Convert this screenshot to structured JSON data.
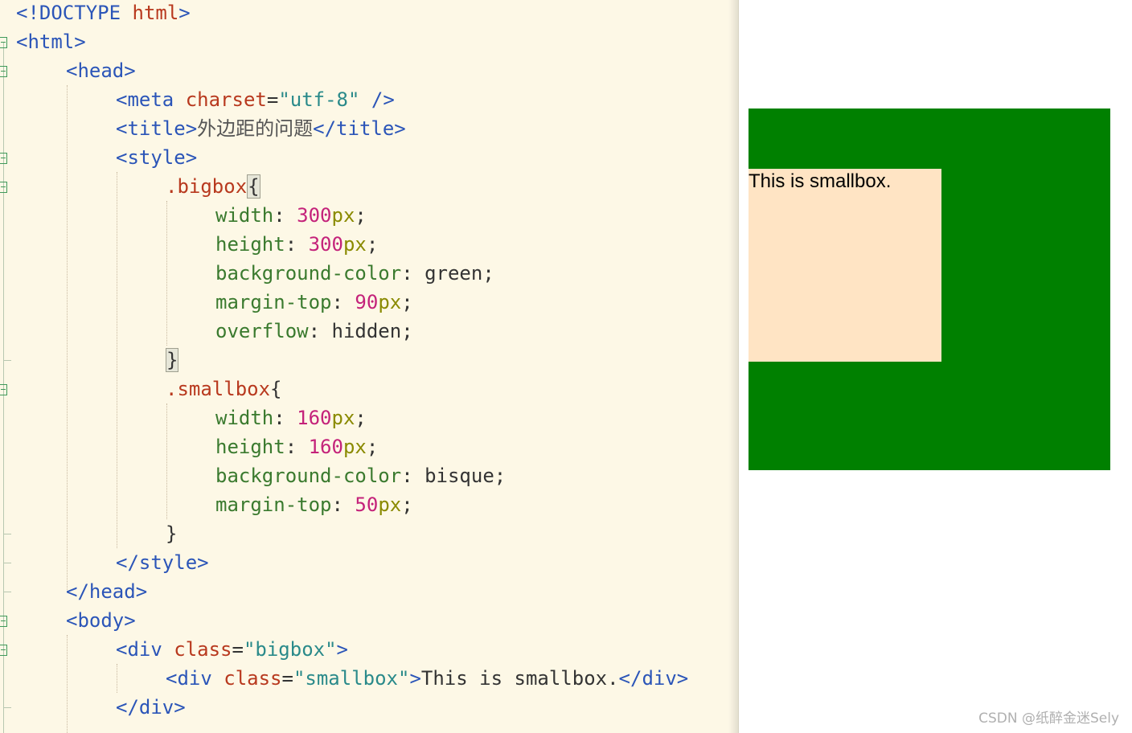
{
  "editor": {
    "lines": [
      {
        "indent": 0,
        "fold": false,
        "tokens": [
          [
            "tag",
            "<!DOCTYPE "
          ],
          [
            "attr",
            "html"
          ],
          [
            "tag",
            ">"
          ]
        ]
      },
      {
        "indent": 0,
        "fold": true,
        "tokens": [
          [
            "tag",
            "<html>"
          ]
        ]
      },
      {
        "indent": 1,
        "fold": true,
        "tokens": [
          [
            "tag",
            "<head>"
          ]
        ]
      },
      {
        "indent": 2,
        "fold": false,
        "tokens": [
          [
            "tag",
            "<meta "
          ],
          [
            "attr",
            "charset"
          ],
          [
            "plain",
            "="
          ],
          [
            "str",
            "\"utf-8\""
          ],
          [
            "tag",
            " />"
          ]
        ]
      },
      {
        "indent": 2,
        "fold": false,
        "tokens": [
          [
            "tag",
            "<title>"
          ],
          [
            "cn",
            "外边距的问题"
          ],
          [
            "tag",
            "</title>"
          ]
        ]
      },
      {
        "indent": 2,
        "fold": true,
        "tokens": [
          [
            "tag",
            "<style>"
          ]
        ]
      },
      {
        "indent": 3,
        "fold": true,
        "tokens": [
          [
            "sel",
            ".bigbox"
          ],
          [
            "hl",
            "{"
          ]
        ]
      },
      {
        "indent": 4,
        "fold": false,
        "tokens": [
          [
            "prop",
            "width"
          ],
          [
            "plain",
            ": "
          ],
          [
            "num",
            "300"
          ],
          [
            "unit",
            "px"
          ],
          [
            "plain",
            ";"
          ]
        ]
      },
      {
        "indent": 4,
        "fold": false,
        "tokens": [
          [
            "prop",
            "height"
          ],
          [
            "plain",
            ": "
          ],
          [
            "num",
            "300"
          ],
          [
            "unit",
            "px"
          ],
          [
            "plain",
            ";"
          ]
        ]
      },
      {
        "indent": 4,
        "fold": false,
        "tokens": [
          [
            "prop",
            "background-color"
          ],
          [
            "plain",
            ": green;"
          ]
        ]
      },
      {
        "indent": 4,
        "fold": false,
        "tokens": [
          [
            "prop",
            "margin-top"
          ],
          [
            "plain",
            ": "
          ],
          [
            "num",
            "90"
          ],
          [
            "unit",
            "px"
          ],
          [
            "plain",
            ";"
          ]
        ]
      },
      {
        "indent": 4,
        "fold": false,
        "tokens": [
          [
            "prop",
            "overflow"
          ],
          [
            "plain",
            ": hidden;"
          ]
        ]
      },
      {
        "indent": 3,
        "fold": false,
        "foldend": true,
        "tokens": [
          [
            "hl",
            "}"
          ]
        ]
      },
      {
        "indent": 3,
        "fold": true,
        "tokens": [
          [
            "sel",
            ".smallbox"
          ],
          [
            "plain",
            "{"
          ]
        ]
      },
      {
        "indent": 4,
        "fold": false,
        "tokens": [
          [
            "prop",
            "width"
          ],
          [
            "plain",
            ": "
          ],
          [
            "num",
            "160"
          ],
          [
            "unit",
            "px"
          ],
          [
            "plain",
            ";"
          ]
        ]
      },
      {
        "indent": 4,
        "fold": false,
        "tokens": [
          [
            "prop",
            "height"
          ],
          [
            "plain",
            ": "
          ],
          [
            "num",
            "160"
          ],
          [
            "unit",
            "px"
          ],
          [
            "plain",
            ";"
          ]
        ]
      },
      {
        "indent": 4,
        "fold": false,
        "tokens": [
          [
            "prop",
            "background-color"
          ],
          [
            "plain",
            ": bisque;"
          ]
        ]
      },
      {
        "indent": 4,
        "fold": false,
        "tokens": [
          [
            "prop",
            "margin-top"
          ],
          [
            "plain",
            ": "
          ],
          [
            "num",
            "50"
          ],
          [
            "unit",
            "px"
          ],
          [
            "plain",
            ";"
          ]
        ]
      },
      {
        "indent": 3,
        "fold": false,
        "foldend": true,
        "tokens": [
          [
            "plain",
            "}"
          ]
        ]
      },
      {
        "indent": 2,
        "fold": false,
        "foldend": true,
        "tokens": [
          [
            "tag",
            "</style>"
          ]
        ]
      },
      {
        "indent": 1,
        "fold": false,
        "foldend": true,
        "tokens": [
          [
            "tag",
            "</head>"
          ]
        ]
      },
      {
        "indent": 1,
        "fold": true,
        "tokens": [
          [
            "tag",
            "<body>"
          ]
        ]
      },
      {
        "indent": 2,
        "fold": true,
        "tokens": [
          [
            "tag",
            "<div "
          ],
          [
            "attr",
            "class"
          ],
          [
            "plain",
            "="
          ],
          [
            "str",
            "\"bigbox\""
          ],
          [
            "tag",
            ">"
          ]
        ]
      },
      {
        "indent": 3,
        "fold": false,
        "tokens": [
          [
            "tag",
            "<div "
          ],
          [
            "attr",
            "class"
          ],
          [
            "plain",
            "="
          ],
          [
            "str",
            "\"smallbox\""
          ],
          [
            "tag",
            ">"
          ],
          [
            "plain",
            "This is smallbox."
          ],
          [
            "tag",
            "</div>"
          ]
        ]
      },
      {
        "indent": 2,
        "fold": false,
        "foldend": true,
        "tokens": [
          [
            "tag",
            "</div>"
          ]
        ]
      }
    ]
  },
  "preview": {
    "smallbox_text": "This is smallbox.",
    "colors": {
      "bigbox": "#008000",
      "smallbox": "#ffe4c4"
    }
  },
  "watermark": "CSDN @纸醉金迷Sely"
}
